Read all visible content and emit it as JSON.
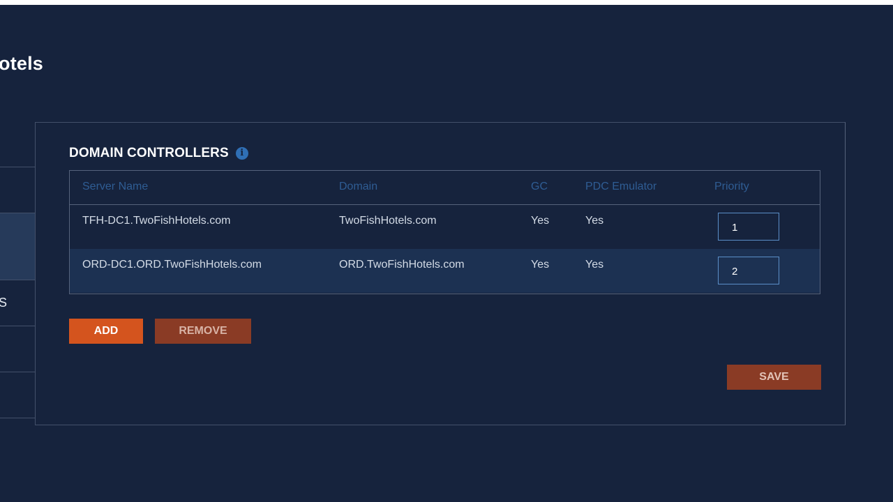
{
  "page": {
    "title": "otels"
  },
  "side_tabs": [
    {
      "label": ""
    },
    {
      "label": ""
    },
    {
      "label": ""
    },
    {
      "label": "S"
    },
    {
      "label": ""
    },
    {
      "label": ""
    }
  ],
  "section": {
    "title": "DOMAIN CONTROLLERS",
    "info_icon": "i"
  },
  "table": {
    "columns": [
      "Server Name",
      "Domain",
      "GC",
      "PDC Emulator",
      "Priority"
    ],
    "rows": [
      {
        "server": "TFH-DC1.TwoFishHotels.com",
        "domain": "TwoFishHotels.com",
        "gc": "Yes",
        "pdc": "Yes",
        "priority": "1"
      },
      {
        "server": "ORD-DC1.ORD.TwoFishHotels.com",
        "domain": "ORD.TwoFishHotels.com",
        "gc": "Yes",
        "pdc": "Yes",
        "priority": "2"
      }
    ]
  },
  "buttons": {
    "add": "ADD",
    "remove": "REMOVE",
    "save": "SAVE"
  },
  "colors": {
    "background": "#16233d",
    "accent": "#d4541e",
    "muted_button": "#8a3b25",
    "header_text": "#2f5d94",
    "selected_row": "#1c3152"
  }
}
